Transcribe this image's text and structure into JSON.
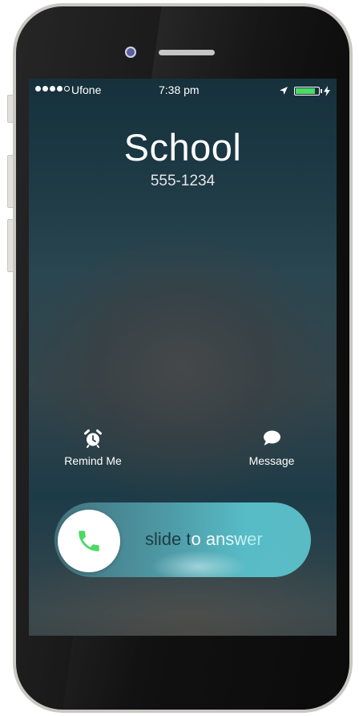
{
  "status_bar": {
    "carrier": "Ufone",
    "time": "7:38 pm",
    "signal_bars_filled": 4,
    "signal_bars_total": 5,
    "battery_level": 0.85,
    "location_icon": "location-arrow-icon",
    "charging_icon": "bolt-icon",
    "battery_color": "#4cd964"
  },
  "caller": {
    "name": "School",
    "number": "555-1234"
  },
  "actions": {
    "remind_label": "Remind Me",
    "remind_icon": "alarm-clock-icon",
    "message_label": "Message",
    "message_icon": "speech-bubble-icon"
  },
  "slider": {
    "label": "slide to answer",
    "knob_icon": "phone-handset-icon",
    "icon_color": "#4cd964"
  }
}
